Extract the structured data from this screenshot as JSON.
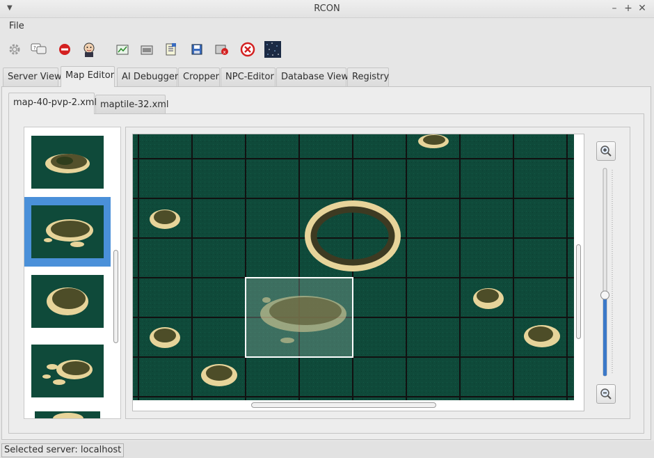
{
  "window": {
    "title": "RCON"
  },
  "menubar": {
    "items": [
      "File"
    ]
  },
  "toolbar": {
    "buttons": [
      {
        "icon": "gear-icon"
      },
      {
        "icon": "chat-bubbles-icon"
      },
      {
        "icon": "stop-icon"
      },
      {
        "icon": "jenkins-icon"
      },
      {
        "icon": "image-chart-icon"
      },
      {
        "icon": "open-folder-icon"
      },
      {
        "icon": "document-list-icon"
      },
      {
        "icon": "save-icon"
      },
      {
        "icon": "server-error-icon"
      },
      {
        "icon": "close-circle-icon"
      },
      {
        "icon": "starfield-icon"
      }
    ]
  },
  "main_tabs": {
    "items": [
      "Server View",
      "Map Editor",
      "AI Debugger",
      "Cropper",
      "NPC-Editor",
      "Database View",
      "Registry"
    ],
    "active": "Map Editor"
  },
  "sub_tabs": {
    "items": [
      "map-40-pvp-2.xml",
      "maptile-32.xml"
    ],
    "active": "map-40-pvp-2.xml"
  },
  "status": {
    "text": "Selected server: localhost"
  },
  "colors": {
    "ocean": "#0f4a3a",
    "grid": "#111111",
    "selection": "#4a90d9",
    "stop": "#d32020"
  }
}
